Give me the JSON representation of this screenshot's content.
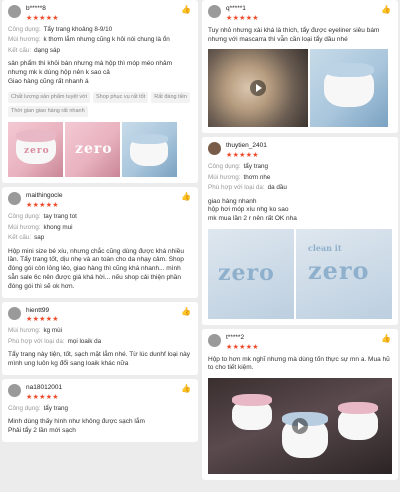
{
  "reviews_left": [
    {
      "user": "b*****8",
      "stars": "★★★★★",
      "attrs": [
        {
          "k": "Công dụng:",
          "v": "Tẩy trang khoảng 8-9/10"
        },
        {
          "k": "Mùi hương:",
          "v": "k thơm lắm nhưng cũng k hôi nói chung là ổn"
        },
        {
          "k": "Kết cấu:",
          "v": "dạng sáp"
        }
      ],
      "text": "sản phẩm thì khỏi bàn nhưng mà hộp thì móp méo nhâm nhưng mk k dùng hộp nên k sao cả\nGiao hàng cũng rất nhanh á",
      "tags": [
        "Chất lượng sản phẩm tuyệt vời",
        "Shop phục vụ rất tốt",
        "Rất đáng tiền",
        "Thời gian giao hàng rất nhanh"
      ]
    },
    {
      "user": "maithingocle",
      "stars": "★★★★★",
      "attrs": [
        {
          "k": "Công dụng:",
          "v": "tay trang tot"
        },
        {
          "k": "Mùi hương:",
          "v": "khong mui"
        },
        {
          "k": "Kết cấu:",
          "v": "sap"
        }
      ],
      "text": "Hộp mini size bé xíu, nhưng chắc cũng dùng được khá nhiều lần. Tẩy trang tốt, dịu nhẹ và an toàn cho da nhạy cảm. Shop đóng gói còn lỏng lẻo, giao hàng thì cũng khá nhanh... mình sẵn sale 6c nên được giá khá hời... nếu shop cải thiện phần đóng gói thì sẽ ok hơn."
    },
    {
      "user": "hientt99",
      "stars": "★★★★★",
      "attrs": [
        {
          "k": "Mùi hương:",
          "v": "kg mùi"
        },
        {
          "k": "Phù hợp với loại da:",
          "v": "mọi loaik da"
        }
      ],
      "text": "Tẩy trang này tiện, tốt, sạch mặt lắm nhé. Từ lúc dunhf loại này mình ung luôn kg đổi sang loaik khác nữa"
    },
    {
      "user": "na18012001",
      "stars": "★★★★★",
      "attrs": [
        {
          "k": "Công dụng:",
          "v": "tẩy trang"
        }
      ],
      "text": "Minh dùng thấy hình như không được sạch lắm\nPhải tẩy 2 lần mới sạch"
    }
  ],
  "reviews_right": [
    {
      "user": "q*****1",
      "stars": "★★★★★",
      "text": "Tuy nhỏ nhưng xài khá là thích, tẩy được eyeliner siêu bám nhưng với mascarra thì vẫn cần loại tẩy dầu nhé"
    },
    {
      "user": "thuytien_2401",
      "stars": "★★★★★",
      "attrs": [
        {
          "k": "Công dụng:",
          "v": "tẩy trang"
        },
        {
          "k": "Mùi hương:",
          "v": "thơm nhe"
        },
        {
          "k": "Phù hợp với loại da:",
          "v": "da dầu"
        }
      ],
      "text": "giao hàng nhanh\nhộp hơi móp xíu nhg ko sao\nmk mua lần 2 r nên rất OK nha"
    },
    {
      "user": "t*****2",
      "stars": "★★★★★",
      "text": "Hộp to hơn mk nghĩ nhưng mà dùng tốn thực sự mn a. Mua hũ to cho tiết kiệm."
    }
  ],
  "brand_text": "zero",
  "brand_subtext": "clean it",
  "accent_color": "#ee4d2d"
}
